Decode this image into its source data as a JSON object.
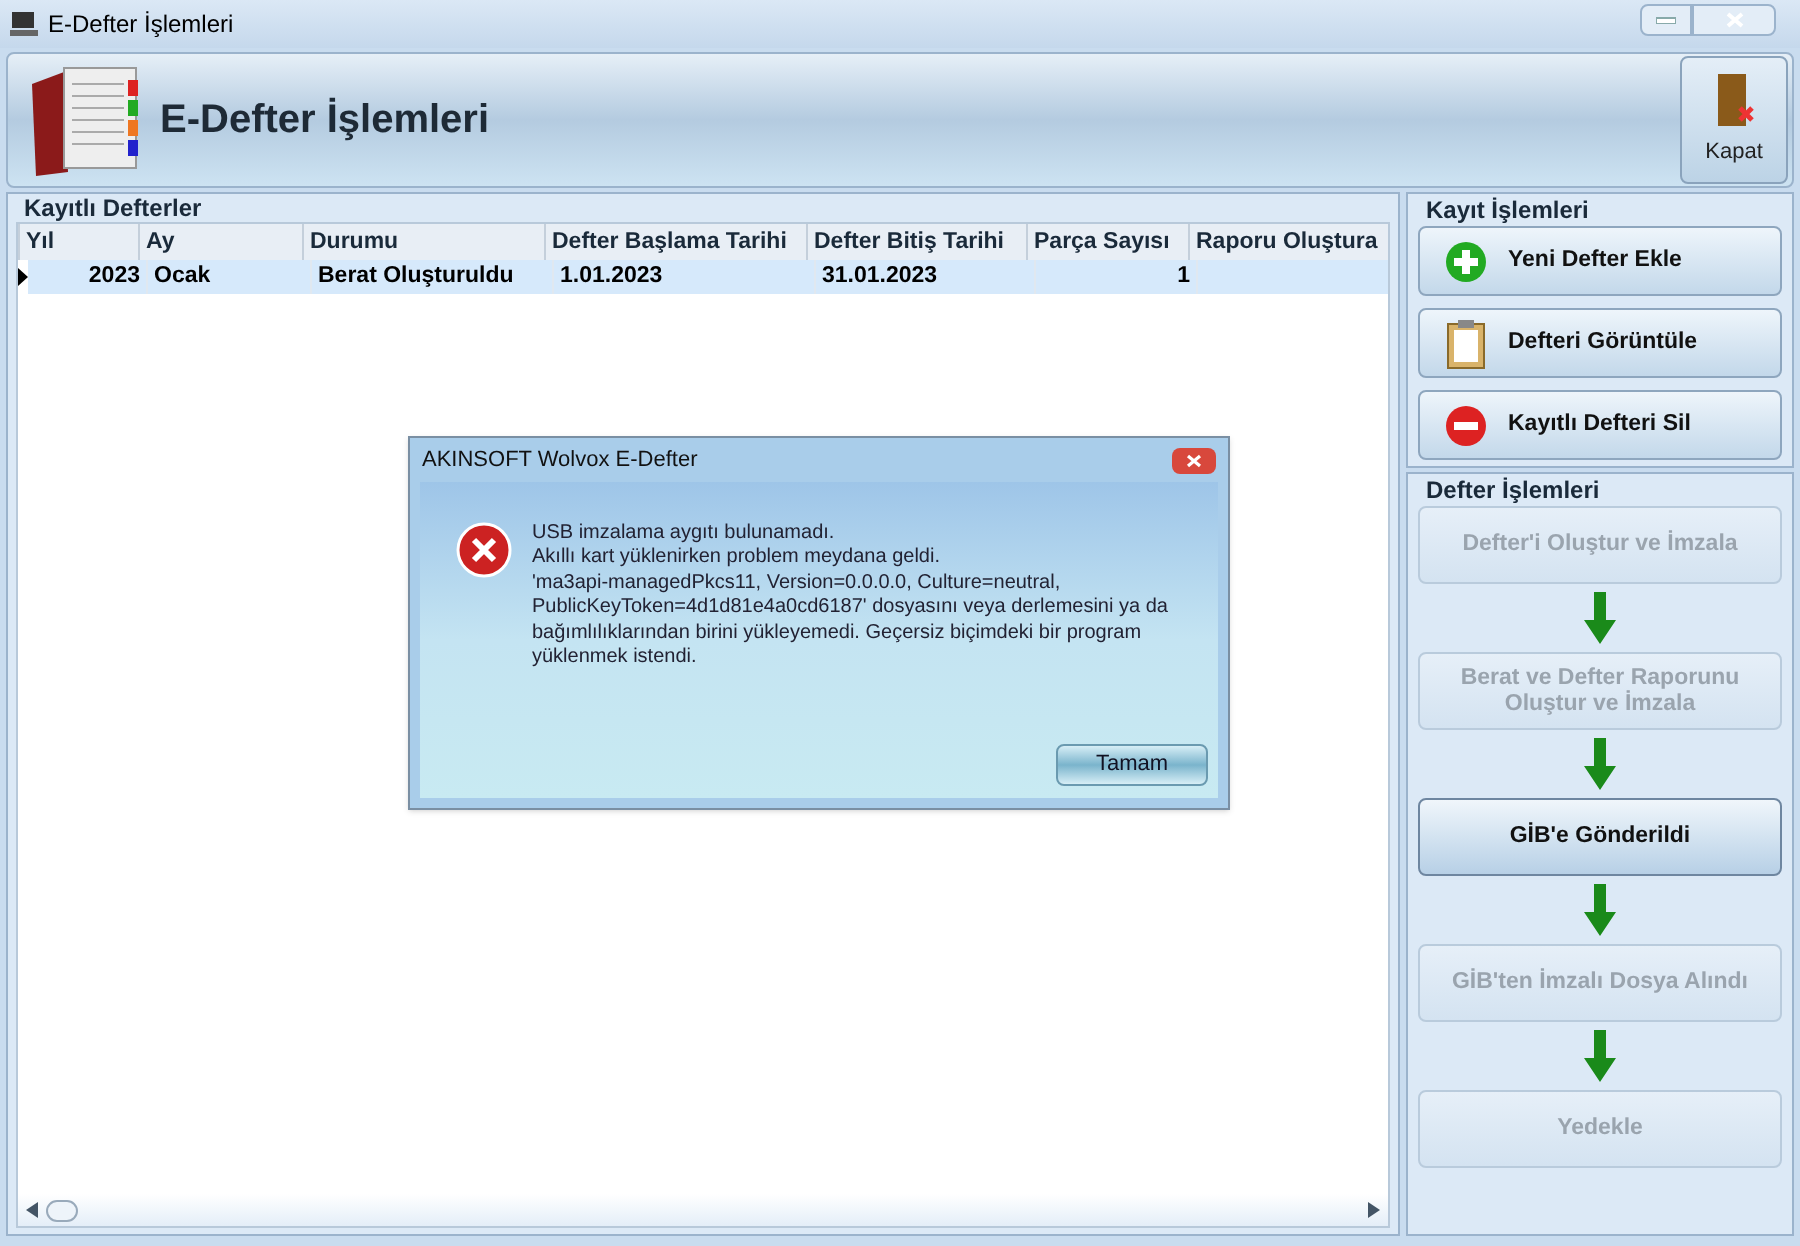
{
  "window": {
    "title": "E-Defter İşlemleri"
  },
  "header": {
    "title": "E-Defter İşlemleri",
    "close_button": "Kapat"
  },
  "records": {
    "title": "Kayıtlı Defterler",
    "columns": [
      "Yıl",
      "Ay",
      "Durumu",
      "Defter Başlama Tarihi",
      "Defter Bitiş Tarihi",
      "Parça Sayısı",
      "Raporu Oluştura"
    ],
    "rows": [
      {
        "selected": true,
        "cells": [
          "2023",
          "Ocak",
          "Berat Oluşturuldu",
          "1.01.2023",
          "31.01.2023",
          "1",
          ""
        ]
      }
    ]
  },
  "record_actions": {
    "title": "Kayıt İşlemleri",
    "buttons": [
      {
        "kind": "add",
        "label": "Yeni Defter Ekle"
      },
      {
        "kind": "view",
        "label": "Defteri Görüntüle"
      },
      {
        "kind": "delete",
        "label": "Kayıtlı Defteri Sil"
      }
    ]
  },
  "ledger_actions": {
    "title": "Defter İşlemleri",
    "steps": [
      {
        "label": "Defter'i Oluştur ve İmzala",
        "disabled": true
      },
      {
        "label": "Berat ve Defter Raporunu Oluştur ve İmzala",
        "disabled": true
      },
      {
        "label": "GİB'e Gönderildi",
        "disabled": false
      },
      {
        "label": "GİB'ten İmzalı Dosya Alındı",
        "disabled": true
      },
      {
        "label": "Yedekle",
        "disabled": true
      }
    ]
  },
  "dialog": {
    "title": "AKINSOFT Wolvox E-Defter",
    "message_lines": [
      "USB imzalama aygıtı bulunamadı.",
      "Akıllı kart yüklenirken problem meydana geldi.",
      "'ma3api-managedPkcs11, Version=0.0.0.0, Culture=neutral,",
      "PublicKeyToken=4d1d81e4a0cd6187' dosyasını veya derlemesini ya da",
      "bağımlılıklarından birini yükleyemedi. Geçersiz biçimdeki bir program",
      "yüklenmek istendi."
    ],
    "button": "Tamam"
  }
}
